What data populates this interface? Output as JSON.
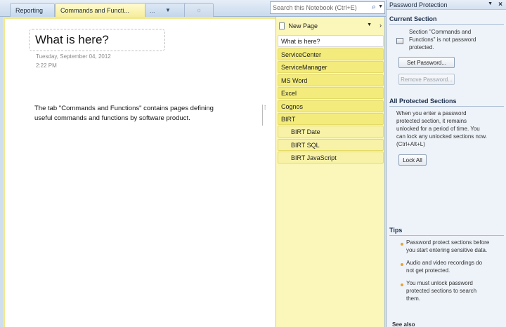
{
  "tabs": {
    "reporting": "Reporting",
    "active": "Commands and Functi...",
    "extra": "...",
    "newtab": "☼"
  },
  "search": {
    "placeholder": "Search this Notebook (Ctrl+E)"
  },
  "page": {
    "title": "What is here?",
    "date": "Tuesday, September  04, 2012",
    "time": "2:22 PM",
    "line1": "The tab \"Commands and Functions\" contains pages  defining",
    "line2": "useful commands and functions by software product."
  },
  "pagelist": {
    "new_page": "New Page",
    "pages": [
      "What is here?",
      "ServiceCenter",
      "ServiceManager",
      "MS Word",
      "Excel",
      "Cognos",
      "BIRT",
      "BIRT Date",
      "BIRT SQL",
      "BIRT JavaScript"
    ]
  },
  "pane": {
    "title": "Password Protection",
    "current_section": {
      "header": "Current Section",
      "line1": "Section \"Commands and",
      "line2": "Functions\" is not password",
      "line3": "protected.",
      "set_button": "Set Password...",
      "remove_button": "Remove Password..."
    },
    "all_protected": {
      "header": "All Protected Sections",
      "lines": [
        "When you enter a password",
        "protected section, it remains",
        "unlocked for a period of time. You",
        "can lock any unlocked sections now.",
        "(Ctrl+Alt+L)"
      ],
      "lock_button": "Lock All"
    },
    "tips": {
      "header": "Tips",
      "tip1": [
        "Password protect sections before",
        "you start entering sensitive data."
      ],
      "tip2": [
        "Audio and video recordings do",
        "not get protected."
      ],
      "tip3": [
        "You must unlock password",
        "protected sections to search",
        "them."
      ]
    },
    "bottom_cut": "See also"
  }
}
